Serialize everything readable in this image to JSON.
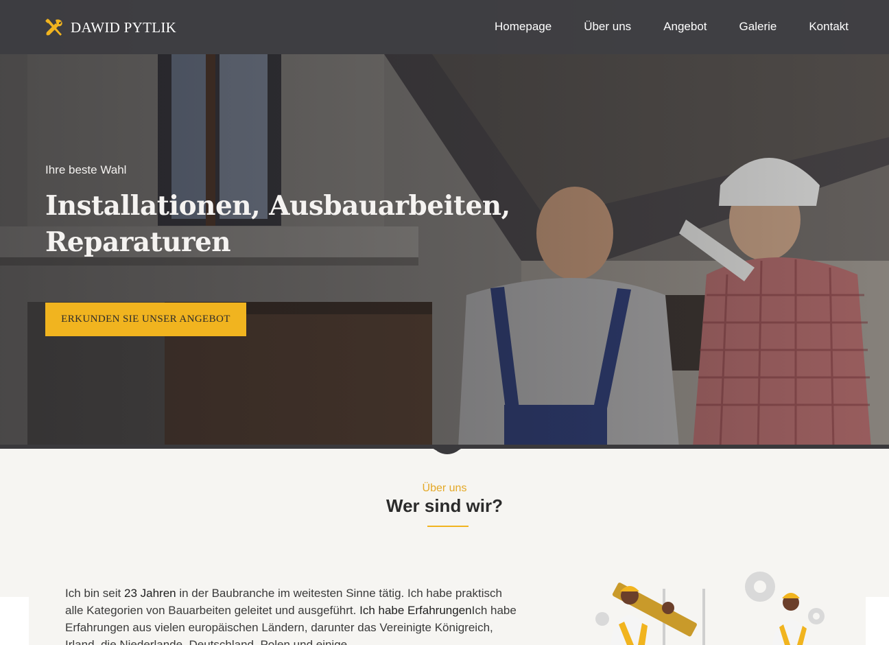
{
  "brand": {
    "name": "DAWID PYTLIK",
    "logo_icon": "tools-icon",
    "accent_color": "#f1b41f"
  },
  "nav": {
    "items": [
      {
        "label": "Homepage"
      },
      {
        "label": "Über uns"
      },
      {
        "label": "Angebot"
      },
      {
        "label": "Galerie"
      },
      {
        "label": "Kontakt"
      }
    ]
  },
  "hero": {
    "kicker": "Ihre beste Wahl",
    "title": "Installationen, Ausbauarbeiten, Reparaturen",
    "button_label": "ERKUNDEN SIE UNSER ANGEBOT"
  },
  "about": {
    "kicker": "Über uns",
    "title": "Wer sind wir?",
    "text": {
      "p1": "Ich bin seit ",
      "years": "23 Jahren",
      "p2": " in der Baubranche im weitesten Sinne tätig. Ich habe praktisch alle Kategorien von Bauarbeiten geleitet und ausgeführt. ",
      "bold": "Ich habe Erfahrungen",
      "p3": "Ich habe Erfahrungen aus vielen europäischen Ländern, darunter das Vereinigte Königreich, Irland, die Niederlande, Deutschland, Polen und einige"
    }
  }
}
